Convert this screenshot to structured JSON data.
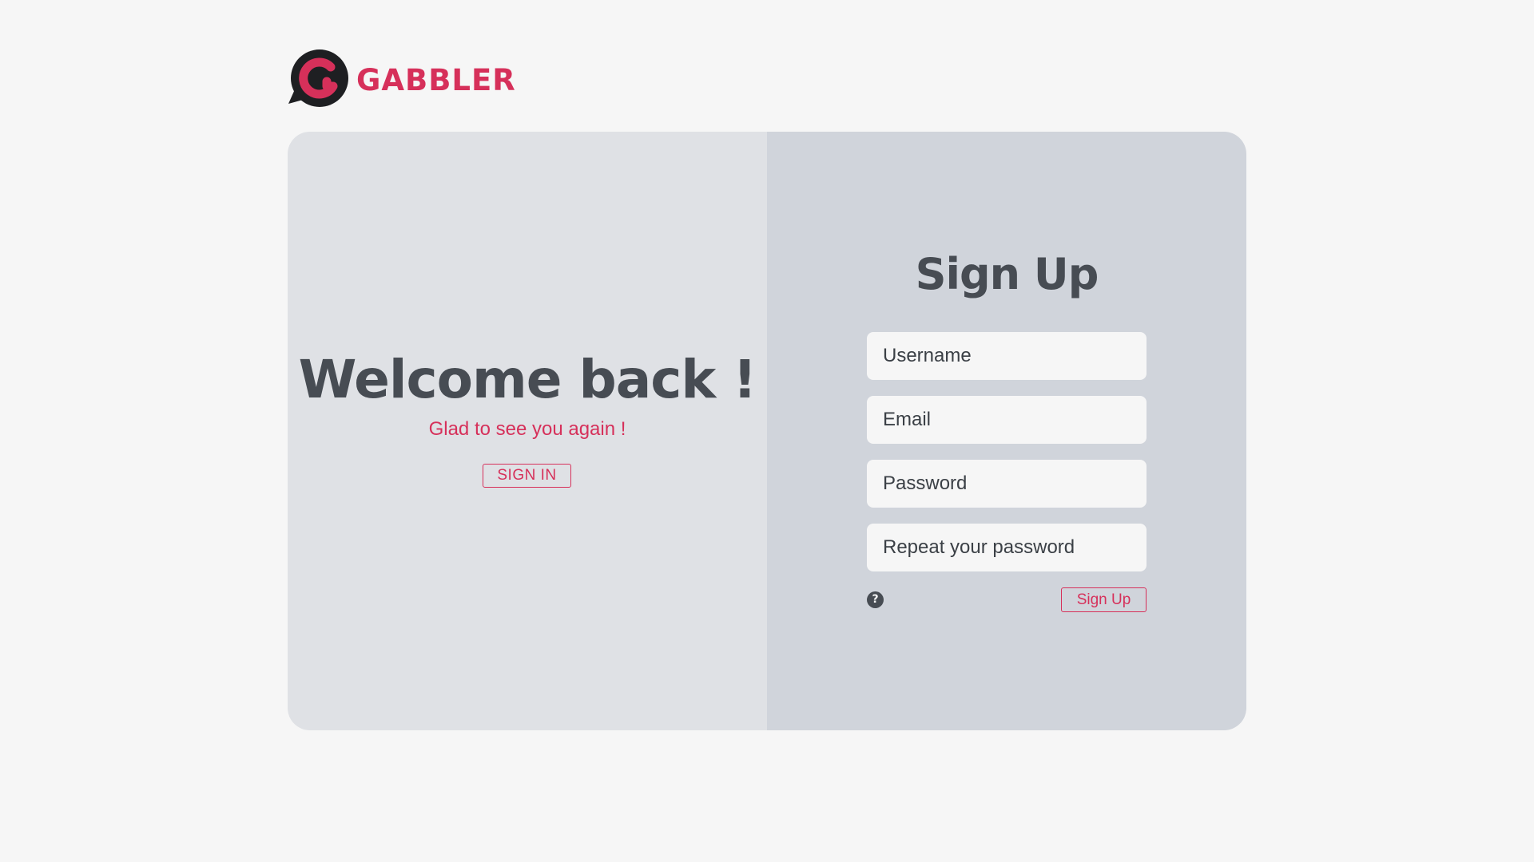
{
  "brand": {
    "name": "GABBLER",
    "logo_icon": "speech-bubble-g-logo",
    "accent_color": "#d6305a",
    "dark_color": "#474c53"
  },
  "welcome_panel": {
    "title": "Welcome back !",
    "subtitle": "Glad to see you again !",
    "signin_label": "SIGN IN"
  },
  "signup_panel": {
    "title": "Sign Up",
    "fields": {
      "username_placeholder": "Username",
      "email_placeholder": "Email",
      "password_placeholder": "Password",
      "repeat_placeholder": "Repeat your password"
    },
    "help_icon": "question-circle-icon",
    "help_glyph": "?",
    "submit_label": "Sign Up"
  },
  "colors": {
    "page_background": "#f6f6f6",
    "left_panel": "#dfe1e5",
    "right_panel": "#d0d4db",
    "input_background": "#f6f6f6"
  }
}
